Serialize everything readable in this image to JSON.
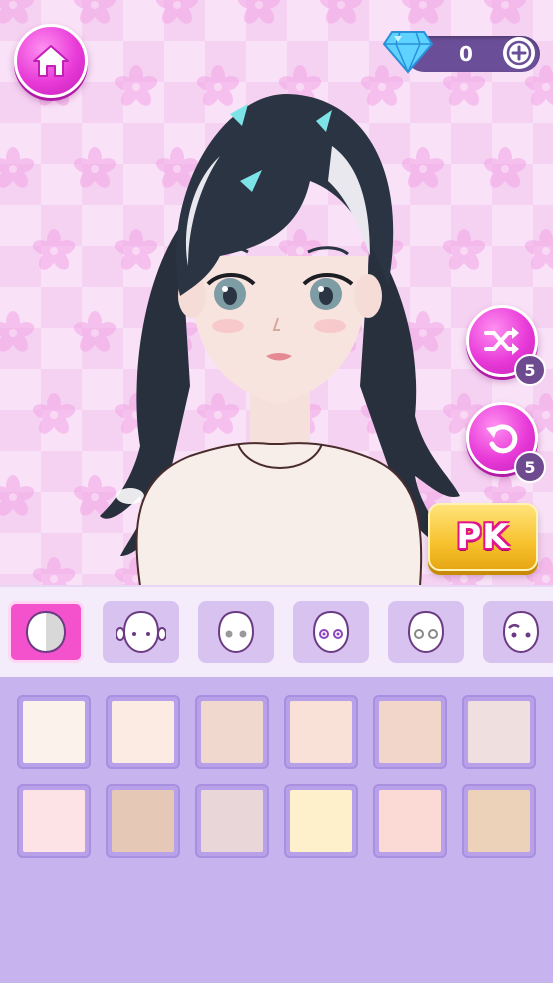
{
  "header": {
    "home_icon": "home-icon",
    "gem_icon": "diamond-icon",
    "gem_count": "0",
    "plus_icon": "plus-icon"
  },
  "side_actions": {
    "shuffle": {
      "icon": "shuffle-icon",
      "count": "5"
    },
    "undo": {
      "icon": "undo-icon",
      "count": "5"
    },
    "pk_label": "PK"
  },
  "tabs": [
    {
      "name": "skin-tone",
      "icon": "skin-tone-icon",
      "active": true
    },
    {
      "name": "face-shape",
      "icon": "face-outline-icon",
      "active": false
    },
    {
      "name": "face-type-2",
      "icon": "face-gray-eyes-icon",
      "active": false
    },
    {
      "name": "eyes",
      "icon": "face-purple-eyes-icon",
      "active": false
    },
    {
      "name": "eyes-2",
      "icon": "face-outline-eyes-icon",
      "active": false
    },
    {
      "name": "brows",
      "icon": "face-brows-icon",
      "active": false
    }
  ],
  "swatches": [
    [
      "#fbf2ec",
      "#fbebe3",
      "#f1d8cf",
      "#f9e1d7",
      "#f3d6ca",
      "#f0dfdf"
    ],
    [
      "#fde3e6",
      "#e5c8b6",
      "#e8d6d9",
      "#fff0cc",
      "#fbd9d5",
      "#ecd2b9"
    ]
  ],
  "colors": {
    "accent": "#f452cc",
    "stage_bg": "#f6d2f2",
    "panel_bg": "#c7b4ee",
    "gold": "#f7c22e"
  }
}
